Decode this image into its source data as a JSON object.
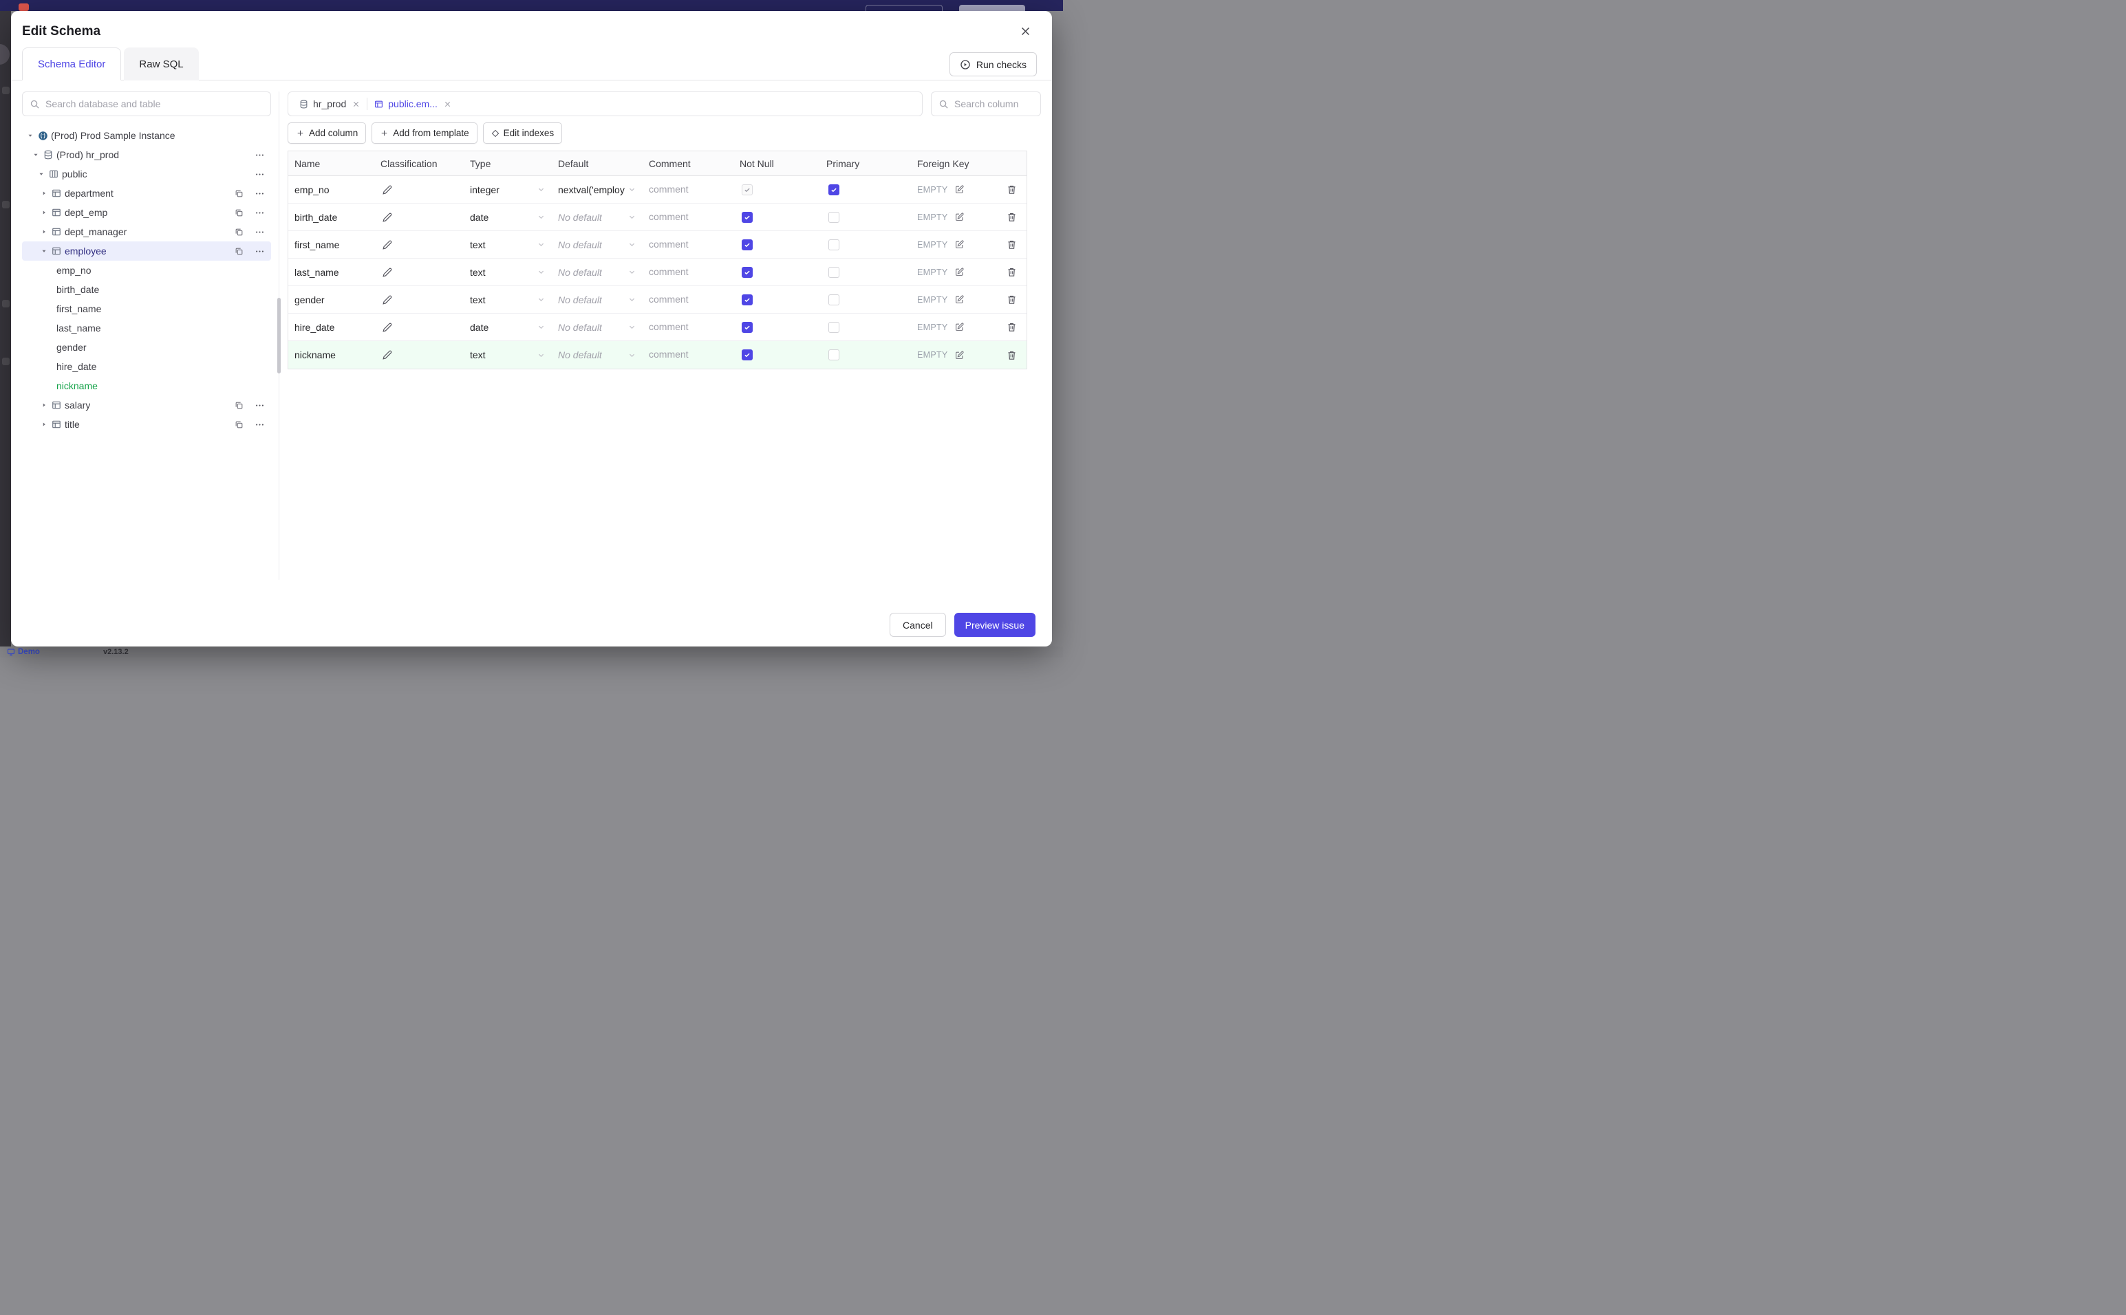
{
  "colors": {
    "accent": "#4f46e5",
    "new_row_green": "#16a34a",
    "new_row_bg": "#f0fdf4"
  },
  "backdrop": {
    "demo_label": "Demo",
    "version": "v2.13.2"
  },
  "modal": {
    "title": "Edit Schema",
    "tabs": [
      {
        "label": "Schema Editor",
        "active": true
      },
      {
        "label": "Raw SQL",
        "active": false
      }
    ],
    "run_checks_label": "Run checks",
    "sidebar": {
      "search_placeholder": "Search database and table",
      "tree": [
        {
          "label": "(Prod) Prod Sample Instance",
          "type": "instance",
          "level": 0,
          "expanded": true
        },
        {
          "label": "(Prod) hr_prod",
          "type": "database",
          "level": 1,
          "expanded": true
        },
        {
          "label": "public",
          "type": "schema",
          "level": 2,
          "expanded": true
        },
        {
          "label": "department",
          "type": "table",
          "level": 3,
          "expanded": false
        },
        {
          "label": "dept_emp",
          "type": "table",
          "level": 3,
          "expanded": false
        },
        {
          "label": "dept_manager",
          "type": "table",
          "level": 3,
          "expanded": false
        },
        {
          "label": "employee",
          "type": "table",
          "level": 3,
          "expanded": true,
          "selected": true
        },
        {
          "label": "emp_no",
          "type": "column",
          "level": 4
        },
        {
          "label": "birth_date",
          "type": "column",
          "level": 4
        },
        {
          "label": "first_name",
          "type": "column",
          "level": 4
        },
        {
          "label": "last_name",
          "type": "column",
          "level": 4
        },
        {
          "label": "gender",
          "type": "column",
          "level": 4
        },
        {
          "label": "hire_date",
          "type": "column",
          "level": 4
        },
        {
          "label": "nickname",
          "type": "column",
          "level": 4,
          "new": true
        },
        {
          "label": "salary",
          "type": "table",
          "level": 3,
          "expanded": false
        },
        {
          "label": "title",
          "type": "table",
          "level": 3,
          "expanded": false
        }
      ]
    },
    "editor": {
      "tabs": [
        {
          "label": "hr_prod",
          "type": "database",
          "active": false
        },
        {
          "label": "public.em...",
          "type": "table",
          "active": true
        }
      ],
      "column_search_placeholder": "Search column",
      "toolbar": {
        "add_column": "Add column",
        "add_from_template": "Add from template",
        "edit_indexes": "Edit indexes"
      },
      "table": {
        "headers": [
          "Name",
          "Classification",
          "Type",
          "Default",
          "Comment",
          "Not Null",
          "Primary",
          "Foreign Key"
        ],
        "comment_placeholder": "comment",
        "rows": [
          {
            "name": "emp_no",
            "type": "integer",
            "default": "nextval('employ",
            "default_is_placeholder": false,
            "not_null": true,
            "not_null_disabled": true,
            "primary": true,
            "foreign_key": "EMPTY",
            "new": false
          },
          {
            "name": "birth_date",
            "type": "date",
            "default": "No default",
            "default_is_placeholder": true,
            "not_null": true,
            "not_null_disabled": false,
            "primary": false,
            "foreign_key": "EMPTY",
            "new": false
          },
          {
            "name": "first_name",
            "type": "text",
            "default": "No default",
            "default_is_placeholder": true,
            "not_null": true,
            "not_null_disabled": false,
            "primary": false,
            "foreign_key": "EMPTY",
            "new": false
          },
          {
            "name": "last_name",
            "type": "text",
            "default": "No default",
            "default_is_placeholder": true,
            "not_null": true,
            "not_null_disabled": false,
            "primary": false,
            "foreign_key": "EMPTY",
            "new": false
          },
          {
            "name": "gender",
            "type": "text",
            "default": "No default",
            "default_is_placeholder": true,
            "not_null": true,
            "not_null_disabled": false,
            "primary": false,
            "foreign_key": "EMPTY",
            "new": false
          },
          {
            "name": "hire_date",
            "type": "date",
            "default": "No default",
            "default_is_placeholder": true,
            "not_null": true,
            "not_null_disabled": false,
            "primary": false,
            "foreign_key": "EMPTY",
            "new": false
          },
          {
            "name": "nickname",
            "type": "text",
            "default": "No default",
            "default_is_placeholder": true,
            "not_null": true,
            "not_null_disabled": false,
            "primary": false,
            "foreign_key": "EMPTY",
            "new": true
          }
        ]
      }
    },
    "footer": {
      "cancel_label": "Cancel",
      "submit_label": "Preview issue"
    }
  }
}
